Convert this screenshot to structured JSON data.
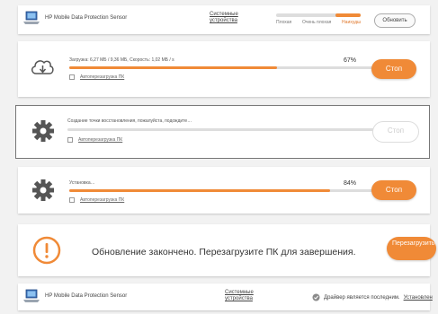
{
  "header": {
    "app_name": "HP Mobile Data Protection Sensor",
    "system_devices_link": "Системные устройства",
    "rating": {
      "labels": [
        "Плохая",
        "Очень плохая",
        "Наихудш"
      ],
      "selected_index": 2,
      "level_fraction": 0.3
    },
    "refresh_label": "Обновить"
  },
  "tasks": [
    {
      "icon": "cloud-download-icon",
      "status": "Загрузка: 6,27 МБ / 9,36 МБ, Скорость: 1,02 МБ / s",
      "percent_label": "67%",
      "progress": 0.67,
      "checkbox_label": "Автоперезагрузка ПК",
      "button_label": "Стоп",
      "button_enabled": true
    },
    {
      "icon": "gear-icon",
      "status": "Создание точки восстановления, пожалуйста, подождите…",
      "percent_label": "",
      "progress": 0,
      "checkbox_label": "Автоперезагрузка ПК",
      "button_label": "Стоп",
      "button_enabled": false
    },
    {
      "icon": "gear-icon",
      "status": "Установка…",
      "percent_label": "84%",
      "progress": 0.84,
      "checkbox_label": "Автоперезагрузка ПК",
      "button_label": "Стоп",
      "button_enabled": true
    }
  ],
  "completion": {
    "icon": "warning-icon",
    "message": "Обновление закончено. Перезагрузите ПК для завершения.",
    "restart_label": "Перезагрузить"
  },
  "footer": {
    "app_name": "HP Mobile Data Protection Sensor",
    "system_devices_link": "Системные устройства",
    "status_text": "Драйвер является последним.",
    "install_link": "Установлен"
  },
  "colors": {
    "accent": "#f08a37",
    "track": "#dddddd",
    "background": "#f2f2f2"
  }
}
